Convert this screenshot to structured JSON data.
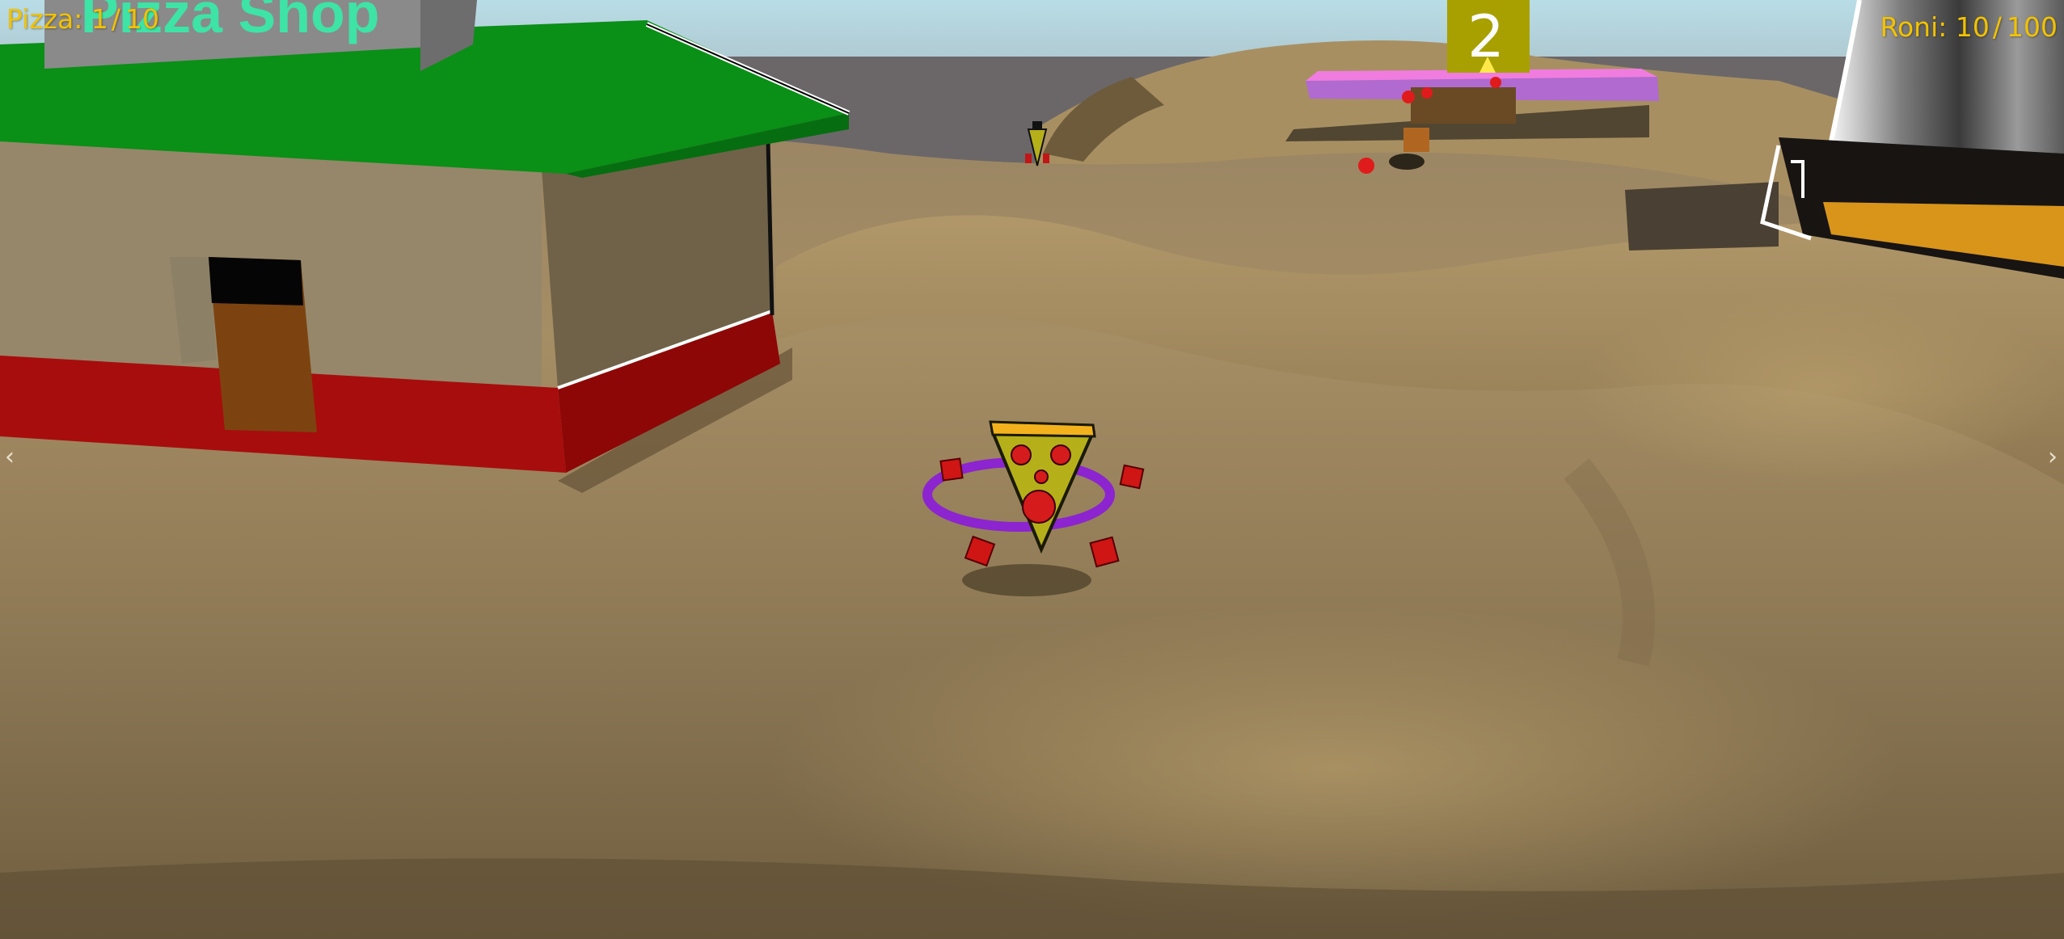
{
  "hud": {
    "pizza_label": "Pizza:",
    "pizza_current": "1",
    "pizza_total": "10",
    "roni_label": "Roni:",
    "roni_current": "10",
    "roni_total": "100"
  },
  "world": {
    "shop_sign": "Pizza Shop",
    "delivery_marker": "2"
  },
  "navigation": {
    "left_glyph": "‹",
    "right_glyph": "›"
  },
  "colors": {
    "hud_text": "#f2c200",
    "sign_text": "#3ee3a6",
    "roof": "#0a8f17",
    "shop_stripe": "#a80d0d",
    "terrain": "#b89b6b",
    "player_cheese": "#b5b01a",
    "player_crust": "#f3b21d",
    "pepperoni": "#d51b1b",
    "ring": "#8b1fd6",
    "marker": "#a8a000",
    "platform": "#b06ad0"
  }
}
